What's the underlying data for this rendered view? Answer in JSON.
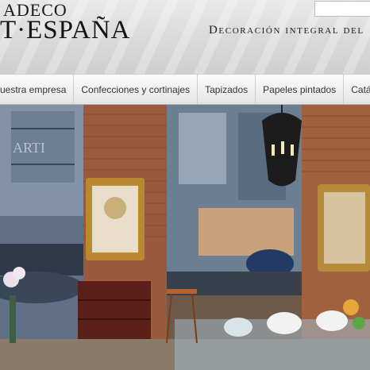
{
  "header": {
    "logo_line1": "ADECO",
    "logo_line2": "T·ESPAÑA",
    "tagline": "Decoración integral del",
    "search": {
      "placeholder": ""
    }
  },
  "nav": {
    "items": [
      {
        "label": "uestra empresa"
      },
      {
        "label": "Confecciones y cortinajes"
      },
      {
        "label": "Tapizados"
      },
      {
        "label": "Papeles pintados"
      },
      {
        "label": "Catálogo de muebles"
      }
    ]
  },
  "hero": {
    "image_text": "ARTI"
  }
}
